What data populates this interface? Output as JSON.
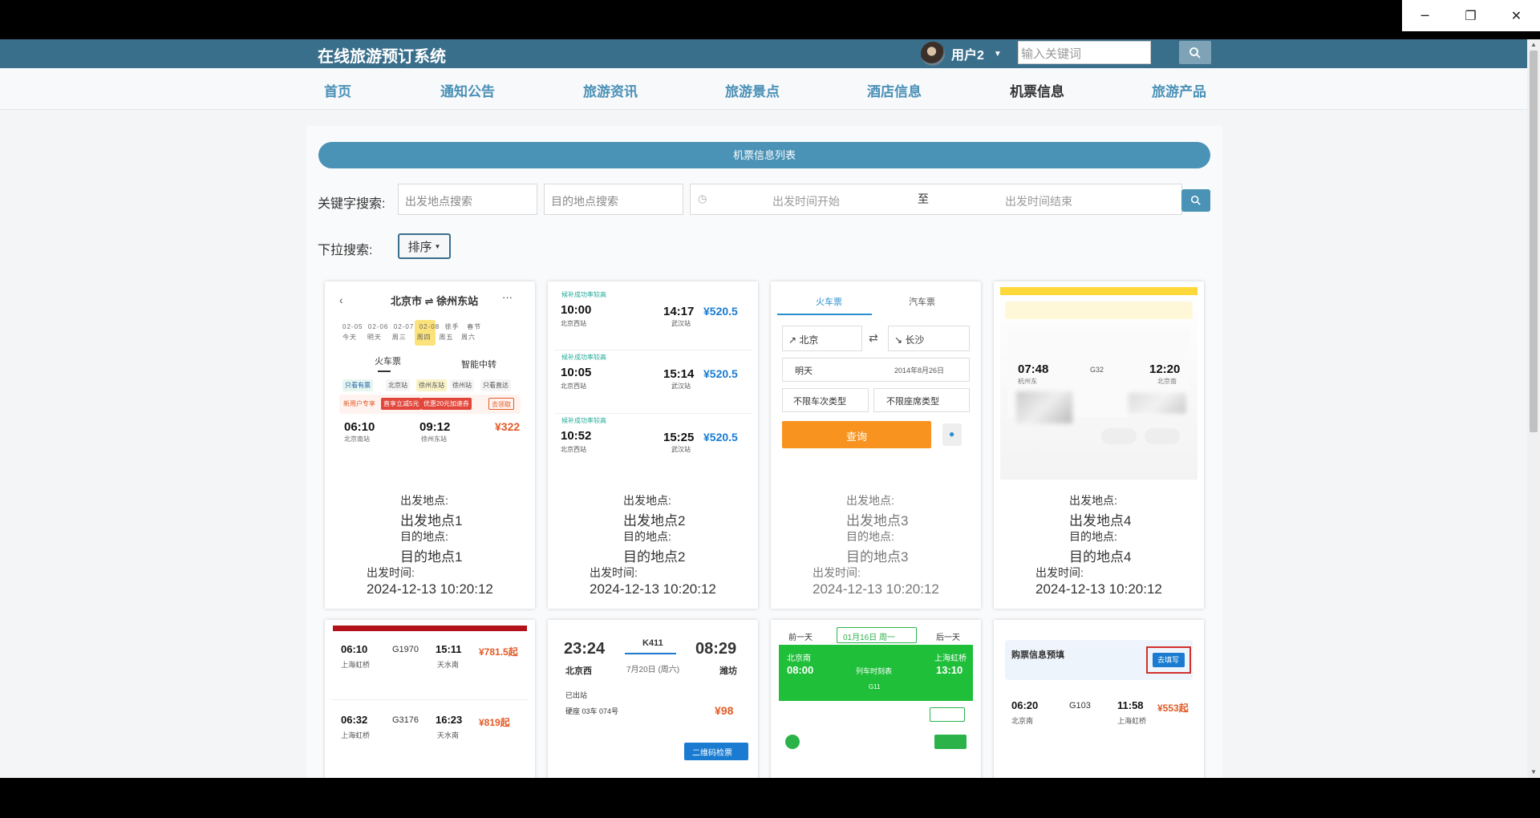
{
  "window": {
    "minimize": "─",
    "restore": "❐",
    "close": "✕"
  },
  "site": {
    "title": "在线旅游预订系统"
  },
  "user": {
    "name": "用户2"
  },
  "header_search": {
    "placeholder": "输入关键词"
  },
  "nav": [
    "首页",
    "通知公告",
    "旅游资讯",
    "旅游景点",
    "酒店信息",
    "机票信息",
    "旅游产品"
  ],
  "nav_active": "机票信息",
  "list_title": "机票信息列表",
  "filters": {
    "keyword_label": "关键字搜索:",
    "origin_placeholder": "出发地点搜索",
    "dest_placeholder": "目的地点搜索",
    "time_start": "出发时间开始",
    "time_sep": "至",
    "time_end": "出发时间结束",
    "dropdown_label": "下拉搜索:",
    "sort_label": "排序"
  },
  "card_labels": {
    "origin": "出发地点:",
    "dest": "目的地点:",
    "time": "出发时间:"
  },
  "cards": [
    {
      "origin": "出发地点1",
      "dest": "目的地点1",
      "time": "2024-12-13 10:20:12"
    },
    {
      "origin": "出发地点2",
      "dest": "目的地点2",
      "time": "2024-12-13 10:20:12"
    },
    {
      "origin": "出发地点3",
      "dest": "目的地点3",
      "time": "2024-12-13 10:20:12"
    },
    {
      "origin": "出发地点4",
      "dest": "目的地点4",
      "time": "2024-12-13 10:20:12"
    }
  ],
  "thumb1": {
    "route": "北京市 ⇌ 徐州东站",
    "tab1": "火车票",
    "tab2": "智能中转",
    "dep": "06:10",
    "arr": "09:12",
    "price": "¥322",
    "s1": "北京南站",
    "s2": "徐州东站"
  },
  "thumb2": {
    "rows": [
      {
        "dep": "10:00",
        "arr": "14:17",
        "price": "¥520.5",
        "from": "北京西站",
        "to": "武汉站"
      },
      {
        "dep": "10:05",
        "arr": "15:14",
        "price": "¥520.5",
        "from": "北京西站",
        "to": "武汉站"
      },
      {
        "dep": "10:52",
        "arr": "15:25",
        "price": "¥520.5",
        "from": "北京西站",
        "to": "武汉站"
      }
    ]
  },
  "thumb3": {
    "tab1": "火车票",
    "tab2": "汽车票",
    "from": "↗ 北京",
    "to": "↘ 长沙",
    "day": "明天",
    "date": "2014年8月26日",
    "opt1": "不限车次类型",
    "opt2": "不限座席类型",
    "query": "查询"
  },
  "thumb4": {
    "dep": "07:48",
    "arr": "12:20",
    "train": "G32",
    "from": "杭州东",
    "to": "北京南"
  },
  "thumb5": {
    "rows": [
      {
        "dep": "06:10",
        "train": "G1970",
        "arr": "15:11",
        "price": "¥781.5起",
        "from": "上海虹桥",
        "to": "天水南"
      },
      {
        "dep": "06:32",
        "train": "G3176",
        "arr": "16:23",
        "price": "¥819起",
        "from": "上海虹桥",
        "to": "天水南"
      }
    ]
  },
  "thumb6": {
    "dep": "23:24",
    "train": "K411",
    "arr": "08:29",
    "from": "北京西",
    "to": "潍坊",
    "date": "7月20日 (周六)",
    "seat": "硬座 03车 074号",
    "price": "¥98",
    "btn": "二维码检票",
    "status": "已出站"
  },
  "thumb7": {
    "prev": "前一天",
    "date": "01月16日 周一",
    "next": "后一天",
    "from": "北京南",
    "to": "上海虹桥",
    "dep": "08:00",
    "arr": "13:10",
    "train": "G11",
    "book": "列车时刻表"
  },
  "thumb8": {
    "title": "购票信息预填",
    "btn": "去填写",
    "dep": "06:20",
    "train": "G103",
    "arr": "11:58",
    "price": "¥553起",
    "from": "北京南",
    "to": "上海虹桥"
  }
}
